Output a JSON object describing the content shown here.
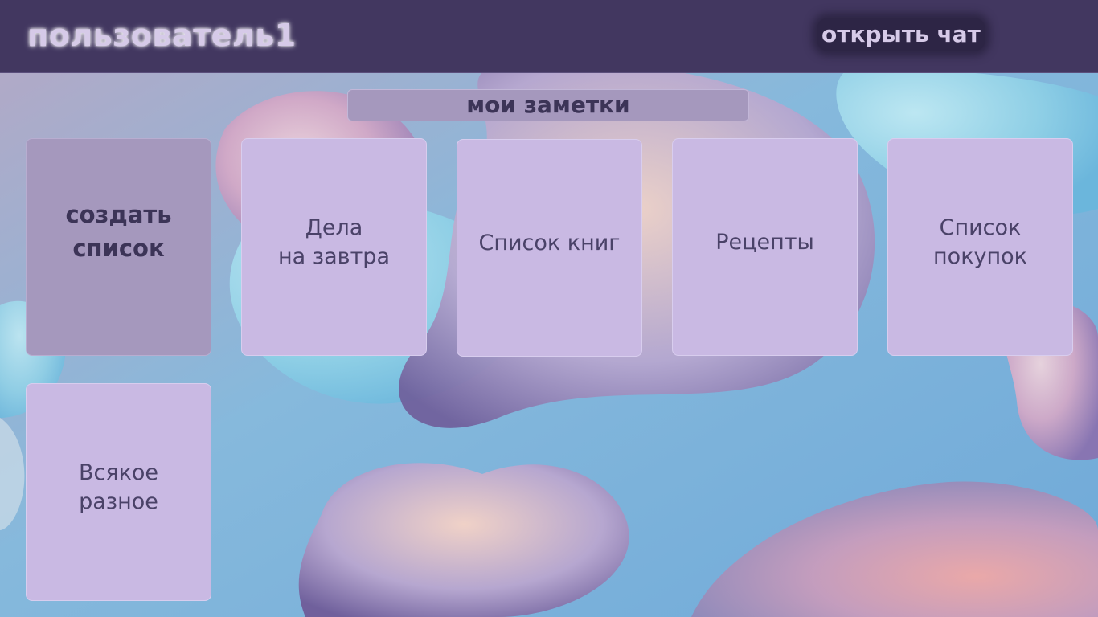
{
  "header": {
    "user_name": "пользователь1",
    "chat_button": "открыть чат"
  },
  "notes": {
    "title": "мои заметки",
    "create_button": "создать\nсписок",
    "lists": [
      {
        "label": "Дела\nна завтра"
      },
      {
        "label": "Список книг"
      },
      {
        "label": "Рецепты"
      },
      {
        "label": "Список\nпокупок"
      },
      {
        "label": "Всякое\nразное"
      }
    ]
  },
  "colors": {
    "header_bg": "#423760",
    "card_bg": "#c9b9e3",
    "create_card_bg": "#a598bd",
    "text_dark": "#3c3457"
  }
}
